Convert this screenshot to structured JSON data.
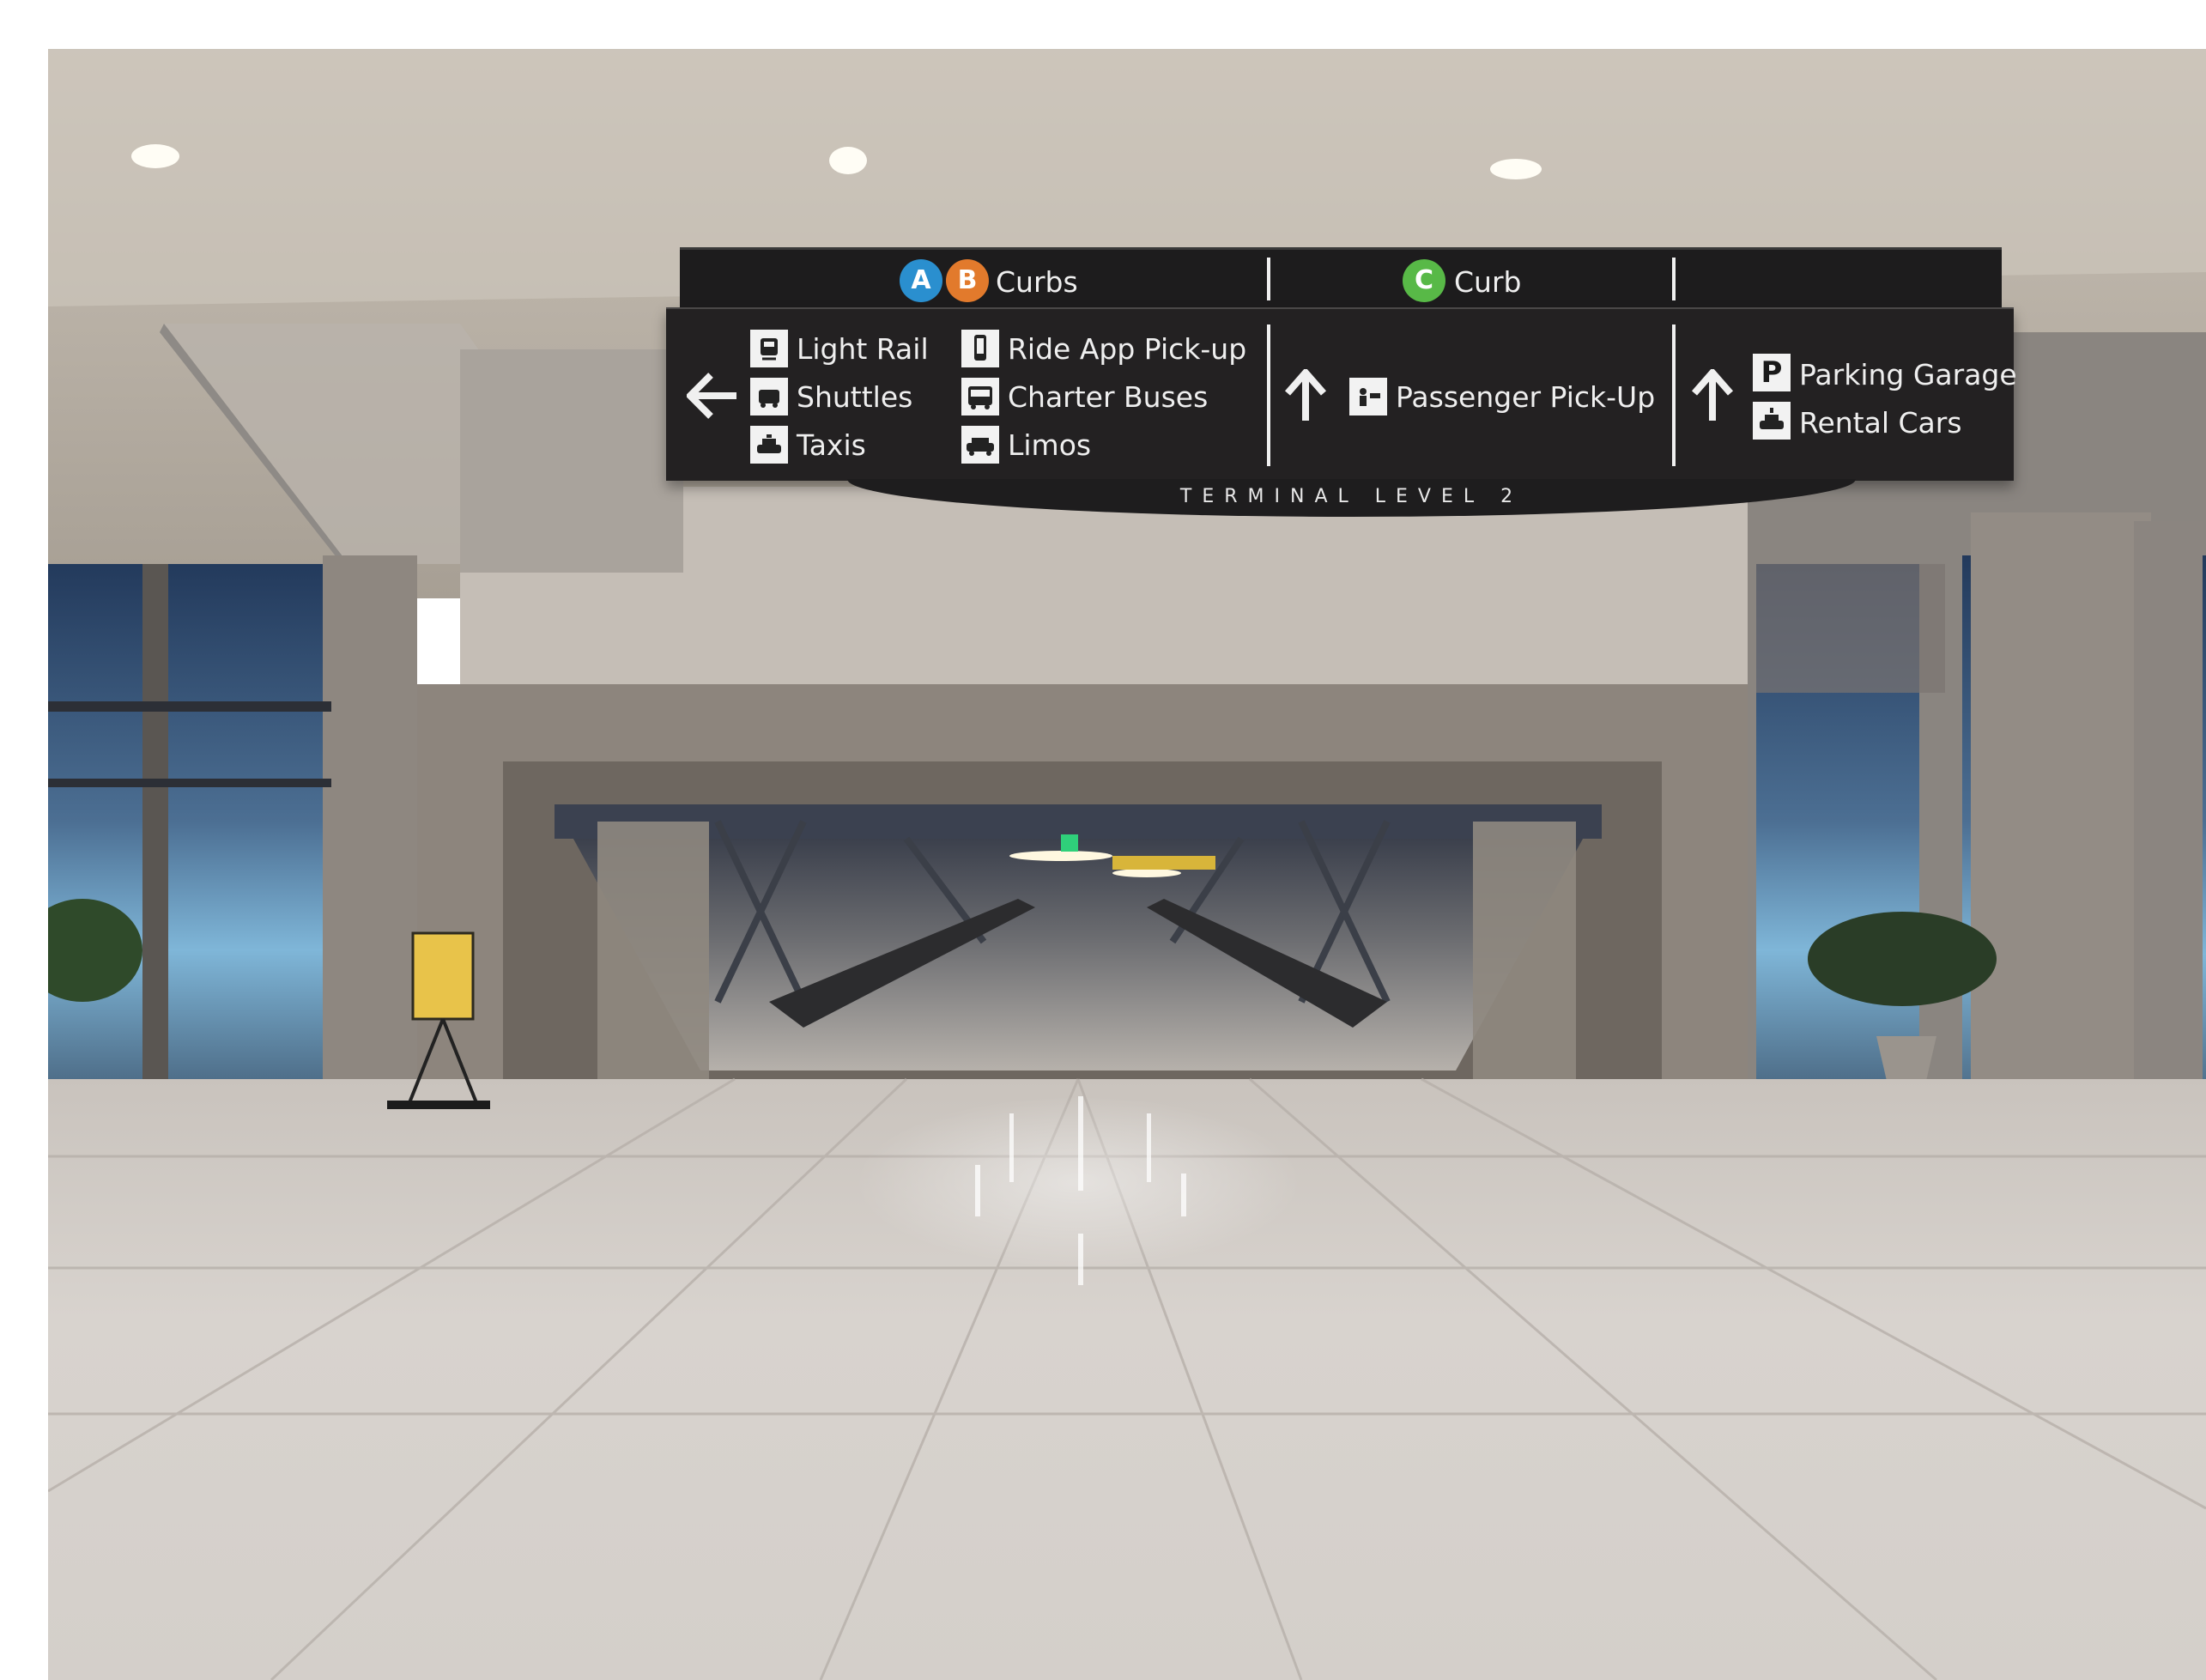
{
  "sign": {
    "ab_curbs": {
      "badge_a": "A",
      "badge_b": "B",
      "label": "Curbs",
      "color_a": "#2a8fcf",
      "color_b": "#e27a2c"
    },
    "c_curb": {
      "badge_c": "C",
      "label": "Curb",
      "color_c": "#58b947"
    },
    "left_group": [
      {
        "icon": "light-rail-icon",
        "label": "Light Rail"
      },
      {
        "icon": "shuttle-icon",
        "label": "Shuttles"
      },
      {
        "icon": "taxi-icon",
        "label": "Taxis"
      },
      {
        "icon": "ride-app-icon",
        "label": "Ride App Pick-up"
      },
      {
        "icon": "charter-bus-icon",
        "label": "Charter Buses"
      },
      {
        "icon": "limo-icon",
        "label": "Limos"
      }
    ],
    "left_arrow": "left-arrow-icon",
    "center": {
      "arrow": "up-arrow-icon",
      "icon": "passenger-pickup-icon",
      "label": "Passenger Pick-Up"
    },
    "right": {
      "arrow": "up-arrow-icon",
      "parking_glyph": "P",
      "parking_label": "Parking Garage",
      "rental_icon": "rental-car-icon",
      "rental_label": "Rental Cars"
    },
    "footer": "TERMINAL LEVEL 2"
  }
}
